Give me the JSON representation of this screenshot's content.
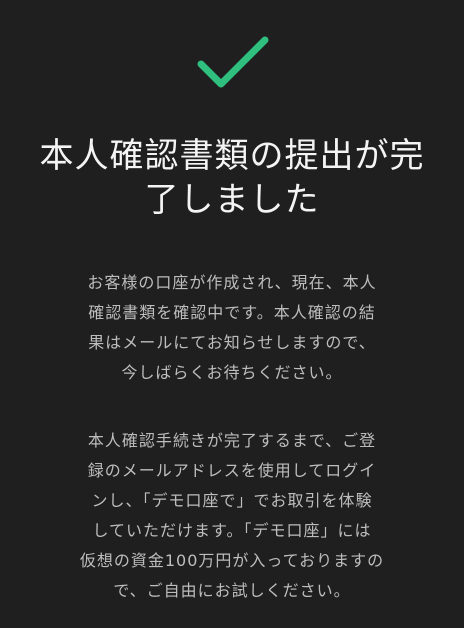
{
  "icons": {
    "check": "check-icon",
    "check_color": "#2fbf7f"
  },
  "content": {
    "title": "本人確認書類の提出が完\n了しました",
    "paragraph1": "お客様の口座が作成され、現在、本人\n確認書類を確認中です。本人確認の結\n果はメールにてお知らせしますので、\n今しばらくお待ちください。",
    "paragraph2": "本人確認手続きが完了するまで、ご登\n録のメールアドレスを使用してログイ\nンし、「デモ口座で」でお取引を体験\nしていただけます。「デモ口座」には\n仮想の資金100万円が入っておりますの\nで、ご自由にお試しください。"
  },
  "colors": {
    "background": "#1f1f1f",
    "title": "#f4f4f4",
    "body": "#bdbdbd"
  }
}
